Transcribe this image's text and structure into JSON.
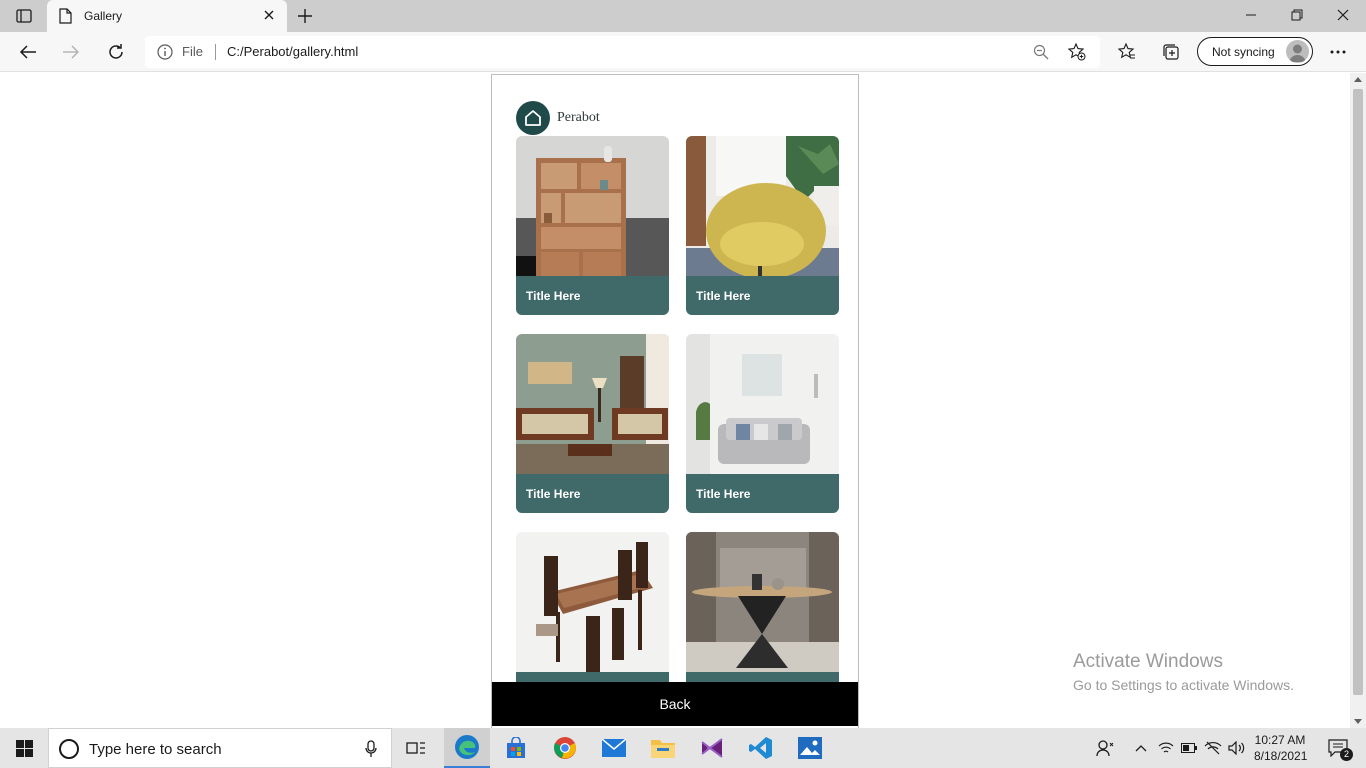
{
  "browser": {
    "tab_title": "Gallery",
    "address_prefix": "File",
    "address_url": "C:/Perabot/gallery.html",
    "sync_label": "Not syncing"
  },
  "page": {
    "brand_name": "Perabot",
    "cards": [
      {
        "title": "Title Here",
        "image": "bookshelf-photo"
      },
      {
        "title": "Title Here",
        "image": "yellow-chair-photo"
      },
      {
        "title": "Title Here",
        "image": "living-room-sofa-photo"
      },
      {
        "title": "Title Here",
        "image": "grey-sofa-photo"
      },
      {
        "title": "",
        "image": "dining-table-photo"
      },
      {
        "title": "",
        "image": "round-table-photo"
      }
    ],
    "back_label": "Back"
  },
  "watermark": {
    "title": "Activate Windows",
    "subtitle": "Go to Settings to activate Windows."
  },
  "taskbar": {
    "search_placeholder": "Type here to search",
    "time": "10:27 AM",
    "date": "8/18/2021",
    "notification_count": "2"
  },
  "colors": {
    "accent_teal": "#20494a",
    "caption_teal": "#265455",
    "back_bar": "#000000"
  }
}
